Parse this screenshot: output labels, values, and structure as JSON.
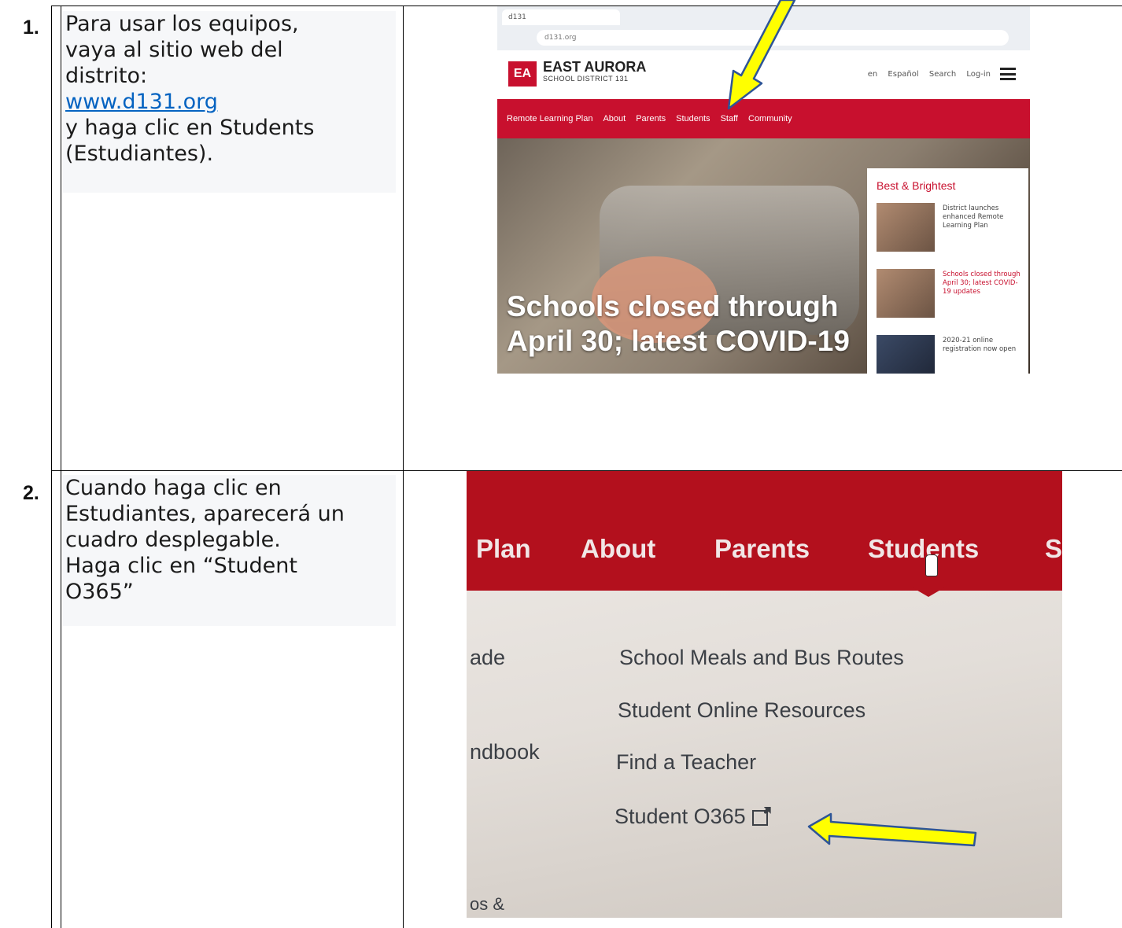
{
  "rows": [
    {
      "number": "1.",
      "lines": [
        "Para usar los equipos,",
        "vaya al sitio web del",
        "distrito:"
      ],
      "link": "www.d131.org",
      "lines_after": [
        "y haga clic en Students",
        "(Estudiantes)."
      ]
    },
    {
      "number": "2.",
      "lines": [
        "Cuando haga clic en",
        "Estudiantes, aparecerá un",
        "cuadro desplegable.",
        "Haga clic en “Student",
        "O365”"
      ]
    }
  ],
  "screenshot1": {
    "brand": "EAST AURORA",
    "brand_sub": "SCHOOL DISTRICT 131",
    "header_links": [
      "en Español",
      "Search",
      "Log-in"
    ],
    "nav": [
      "Remote Learning Plan",
      "About",
      "Parents",
      "Students",
      "Staff",
      "Community"
    ],
    "headline_lines": [
      "Schools closed through",
      "April 30; latest COVID-19"
    ],
    "panel_title": "Best & Brightest",
    "stories": [
      "District launches enhanced Remote Learning Plan",
      "Schools closed through April 30; latest COVID-19 updates",
      "2020-21 online registration now open"
    ]
  },
  "screenshot2": {
    "nav": [
      "Plan",
      "About",
      "Parents",
      "Students",
      "S"
    ],
    "left_fragments": [
      "ade",
      "ndbook",
      "os &"
    ],
    "dropdown": [
      "School Meals and Bus Routes",
      "Student Online Resources",
      "Find a Teacher",
      "Student O365"
    ]
  },
  "colors": {
    "district_red": "#c8102e",
    "arrow_yellow": "#ffff00",
    "arrow_outline": "#2e5597",
    "link_blue": "#0563c1"
  },
  "icons": [
    "yellow-arrow-icon",
    "external-link-icon",
    "hamburger-menu-icon",
    "hand-cursor-icon"
  ]
}
